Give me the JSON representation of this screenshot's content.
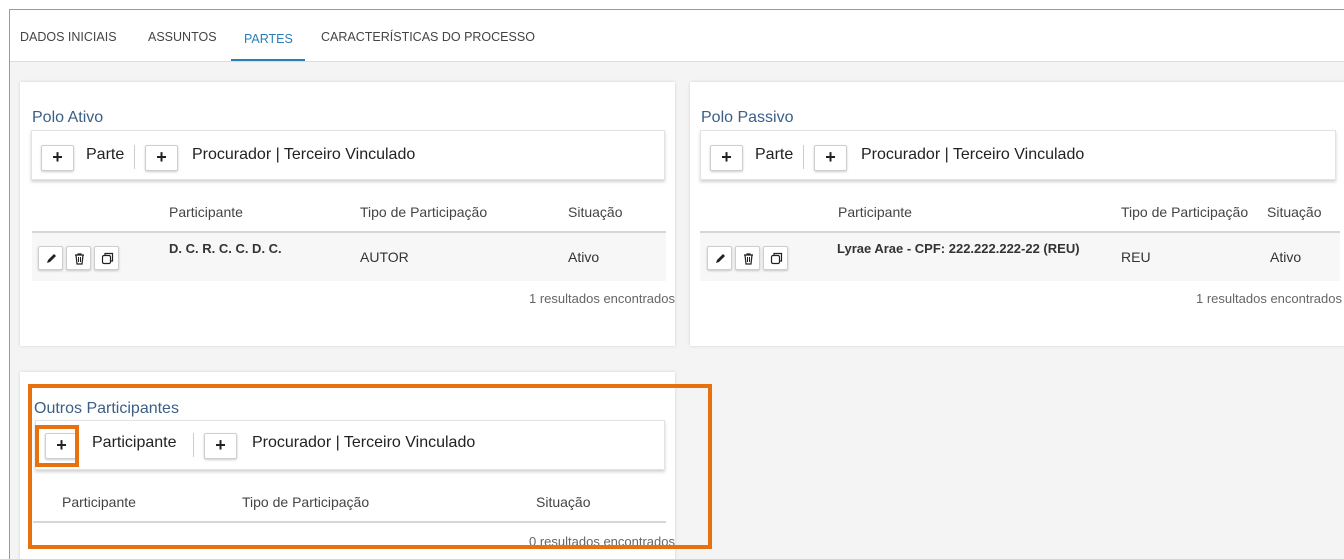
{
  "tabs": [
    {
      "label": "DADOS INICIAIS"
    },
    {
      "label": "ASSUNTOS"
    },
    {
      "label": "PARTES"
    },
    {
      "label": "CARACTERÍSTICAS DO PROCESSO"
    }
  ],
  "polo_ativo": {
    "title": "Polo Ativo",
    "toolbar": {
      "plus": "+",
      "parte": "Parte",
      "procurador": "Procurador | Terceiro Vinculado"
    },
    "columns": [
      "Participante",
      "Tipo de Participação",
      "Situação"
    ],
    "rows": [
      {
        "participante": "D. C. R. C. C. D. C.",
        "tipo": "AUTOR",
        "situacao": "Ativo"
      }
    ],
    "results": "1 resultados encontrados"
  },
  "polo_passivo": {
    "title": "Polo Passivo",
    "toolbar": {
      "plus": "+",
      "parte": "Parte",
      "procurador": "Procurador | Terceiro Vinculado"
    },
    "columns": [
      "Participante",
      "Tipo de Participação",
      "Situação"
    ],
    "rows": [
      {
        "participante": "Lyrae Arae - CPF: 222.222.222-22 (REU)",
        "tipo": "REU",
        "situacao": "Ativo"
      }
    ],
    "results": "1 resultados encontrados"
  },
  "outros": {
    "title": "Outros Participantes",
    "toolbar": {
      "plus": "+",
      "participante": "Participante",
      "procurador": "Procurador | Terceiro Vinculado"
    },
    "columns": [
      "Participante",
      "Tipo de Participação",
      "Situação"
    ],
    "results": "0 resultados encontrados"
  },
  "colors": {
    "accent": "#2a7fb8",
    "highlight": "#e8700f",
    "title": "#3b5f86"
  },
  "icons": {
    "edit": "pencil-icon",
    "delete": "trash-icon",
    "copy": "copy-icon"
  }
}
